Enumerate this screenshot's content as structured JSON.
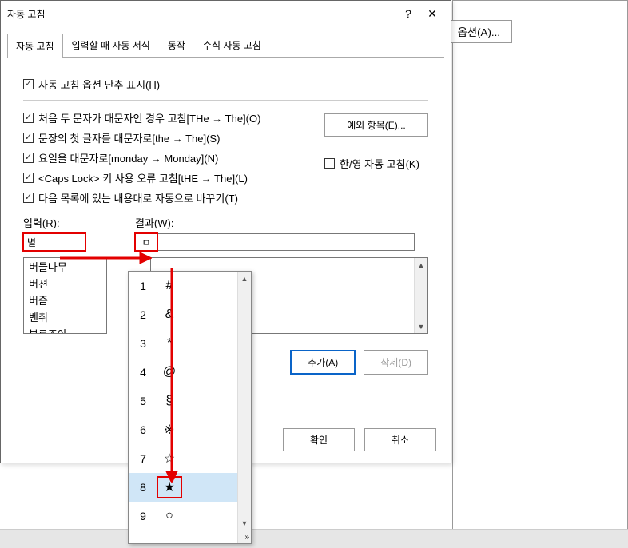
{
  "bgButton": "옵션(A)...",
  "dialog": {
    "title": "자동 고침",
    "help": "?",
    "close": "✕"
  },
  "tabs": {
    "t1": "자동 고침",
    "t2": "입력할 때 자동 서식",
    "t3": "동작",
    "t4": "수식 자동 고침"
  },
  "checks": {
    "c1": "자동 고침 옵션 단추 표시(H)",
    "c2": "처음 두 문자가 대문자인 경우 고침[THe → The](O)",
    "c3": "문장의 첫 글자를 대문자로[the → The](S)",
    "c4": "요일을 대문자로[monday → Monday](N)",
    "c5": "<Caps Lock> 키 사용 오류 고침[tHE → The](L)",
    "c6": "다음 목록에 있는 내용대로 자동으로 바꾸기(T)",
    "c7": "한/영 자동 고침(K)"
  },
  "buttons": {
    "exceptions": "예외 항목(E)...",
    "add": "추가(A)",
    "delete": "삭제(D)",
    "ok": "확인",
    "cancel": "취소"
  },
  "fields": {
    "inputLabel": "입력(R):",
    "resultLabel": "결과(W):",
    "inputValue": "별",
    "resultValue": "ㅁ"
  },
  "list": {
    "i1": "버들나무",
    "i2": "버젼",
    "i3": "버즘",
    "i4": "벤취",
    "i5": "부르조아"
  },
  "ime": {
    "r1n": "1",
    "r1s": "#",
    "r2n": "2",
    "r2s": "&",
    "r3n": "3",
    "r3s": "*",
    "r4n": "4",
    "r4s": "@",
    "r5n": "5",
    "r5s": "§",
    "r6n": "6",
    "r6s": "※",
    "r7n": "7",
    "r7s": "☆",
    "r8n": "8",
    "r8s": "★",
    "r9n": "9",
    "r9s": "○"
  }
}
